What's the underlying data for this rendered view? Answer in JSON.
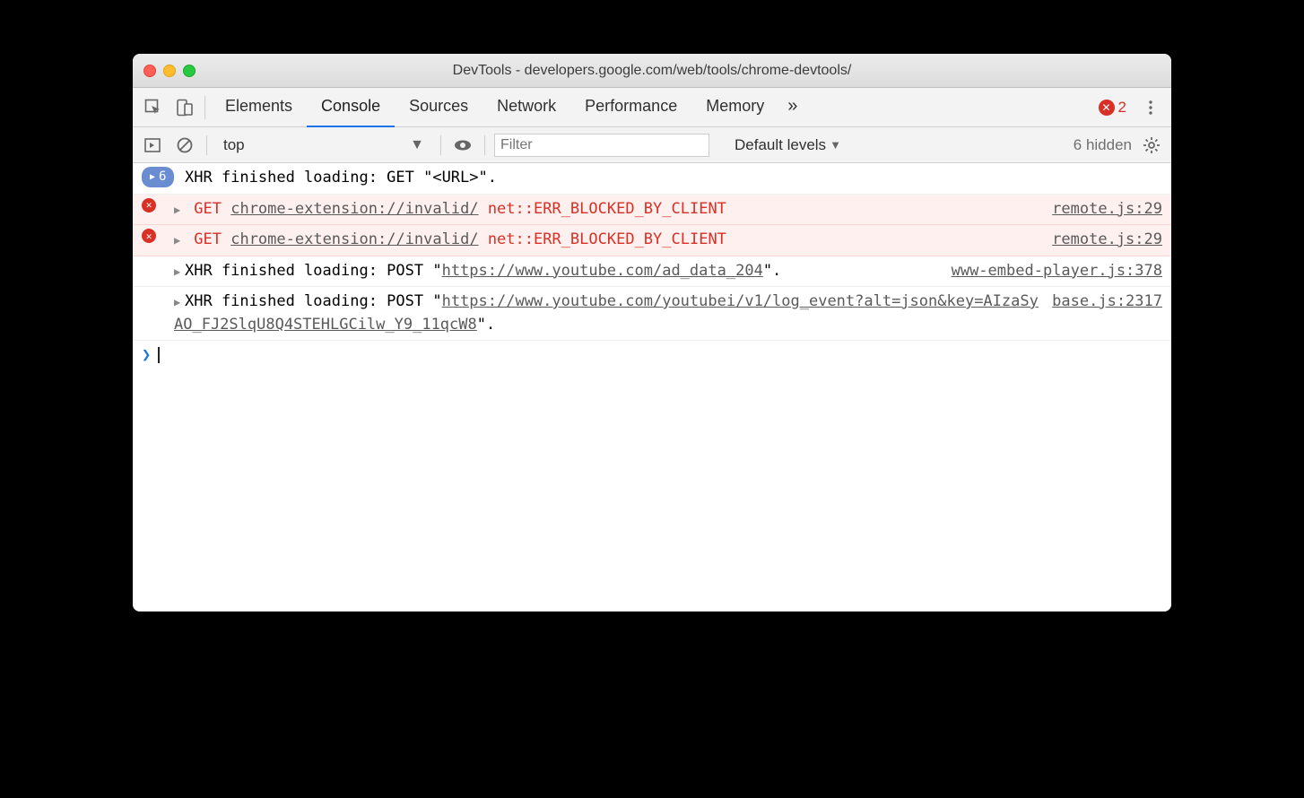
{
  "window": {
    "title": "DevTools - developers.google.com/web/tools/chrome-devtools/"
  },
  "tabs": {
    "items": [
      "Elements",
      "Console",
      "Sources",
      "Network",
      "Performance",
      "Memory"
    ],
    "activeIndex": 1,
    "more_icon": "»",
    "error_count": "2"
  },
  "toolbar": {
    "context_selected": "top",
    "filter_placeholder": "Filter",
    "levels_label": "Default levels",
    "hidden_label": "6 hidden"
  },
  "console_rows": [
    {
      "type": "info-pill",
      "pill_count": "6",
      "text": "XHR finished loading: GET \"<URL>\"."
    },
    {
      "type": "error",
      "method": "GET",
      "url": "chrome-extension://invalid/",
      "message": "net::ERR_BLOCKED_BY_CLIENT",
      "source": "remote.js:29"
    },
    {
      "type": "error",
      "method": "GET",
      "url": "chrome-extension://invalid/",
      "message": "net::ERR_BLOCKED_BY_CLIENT",
      "source": "remote.js:29"
    },
    {
      "type": "log",
      "prefix": "XHR finished loading: POST \"",
      "url": "https://www.youtube.com/ad_data_204",
      "suffix": "\".",
      "source": "www-embed-player.js:378"
    },
    {
      "type": "log",
      "prefix": "XHR finished loading: POST \"",
      "url": "https://www.youtube.com/youtubei/v1/log_event?alt=json&key=AIzaSyAO_FJ2SlqU8Q4STEHLGCilw_Y9_11qcW8",
      "suffix": "\".",
      "source": "base.js:2317"
    }
  ]
}
